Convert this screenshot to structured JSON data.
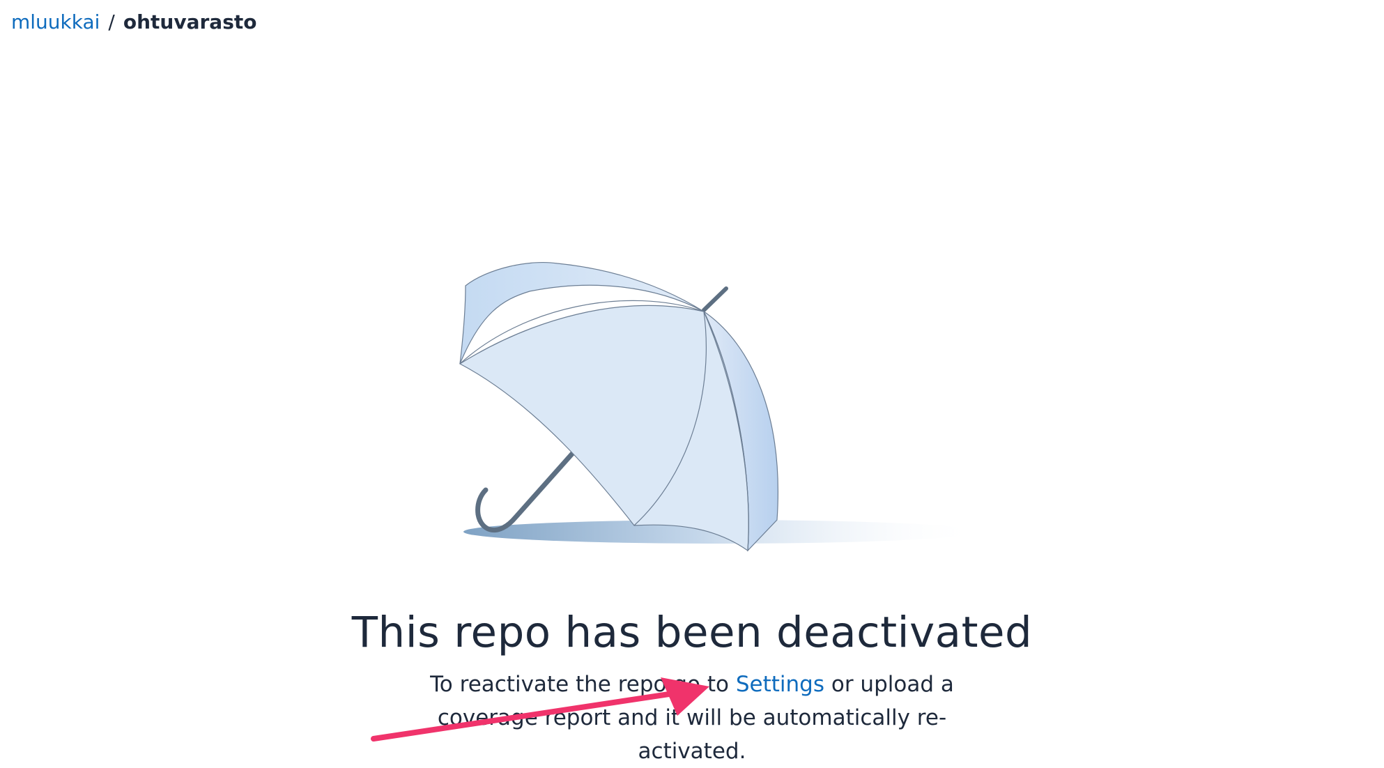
{
  "breadcrumb": {
    "owner": "mluukkai",
    "separator": "/",
    "repo": "ohtuvarasto"
  },
  "main": {
    "illustration_icon": "umbrella-icon",
    "heading": "This repo has been deactivated",
    "message_before": "To reactivate the repo go to ",
    "settings_link": "Settings",
    "message_after": " or upload a coverage report and it will be automatically re-activated."
  },
  "annotation": {
    "icon": "arrow-annotation-icon",
    "color": "#f0336b"
  },
  "colors": {
    "link": "#0e6bbd",
    "text": "#1e293b",
    "umbrella_canopy": "#dbe8f6",
    "umbrella_shade": "#bcd5f0",
    "umbrella_handle": "#5d6f82"
  }
}
